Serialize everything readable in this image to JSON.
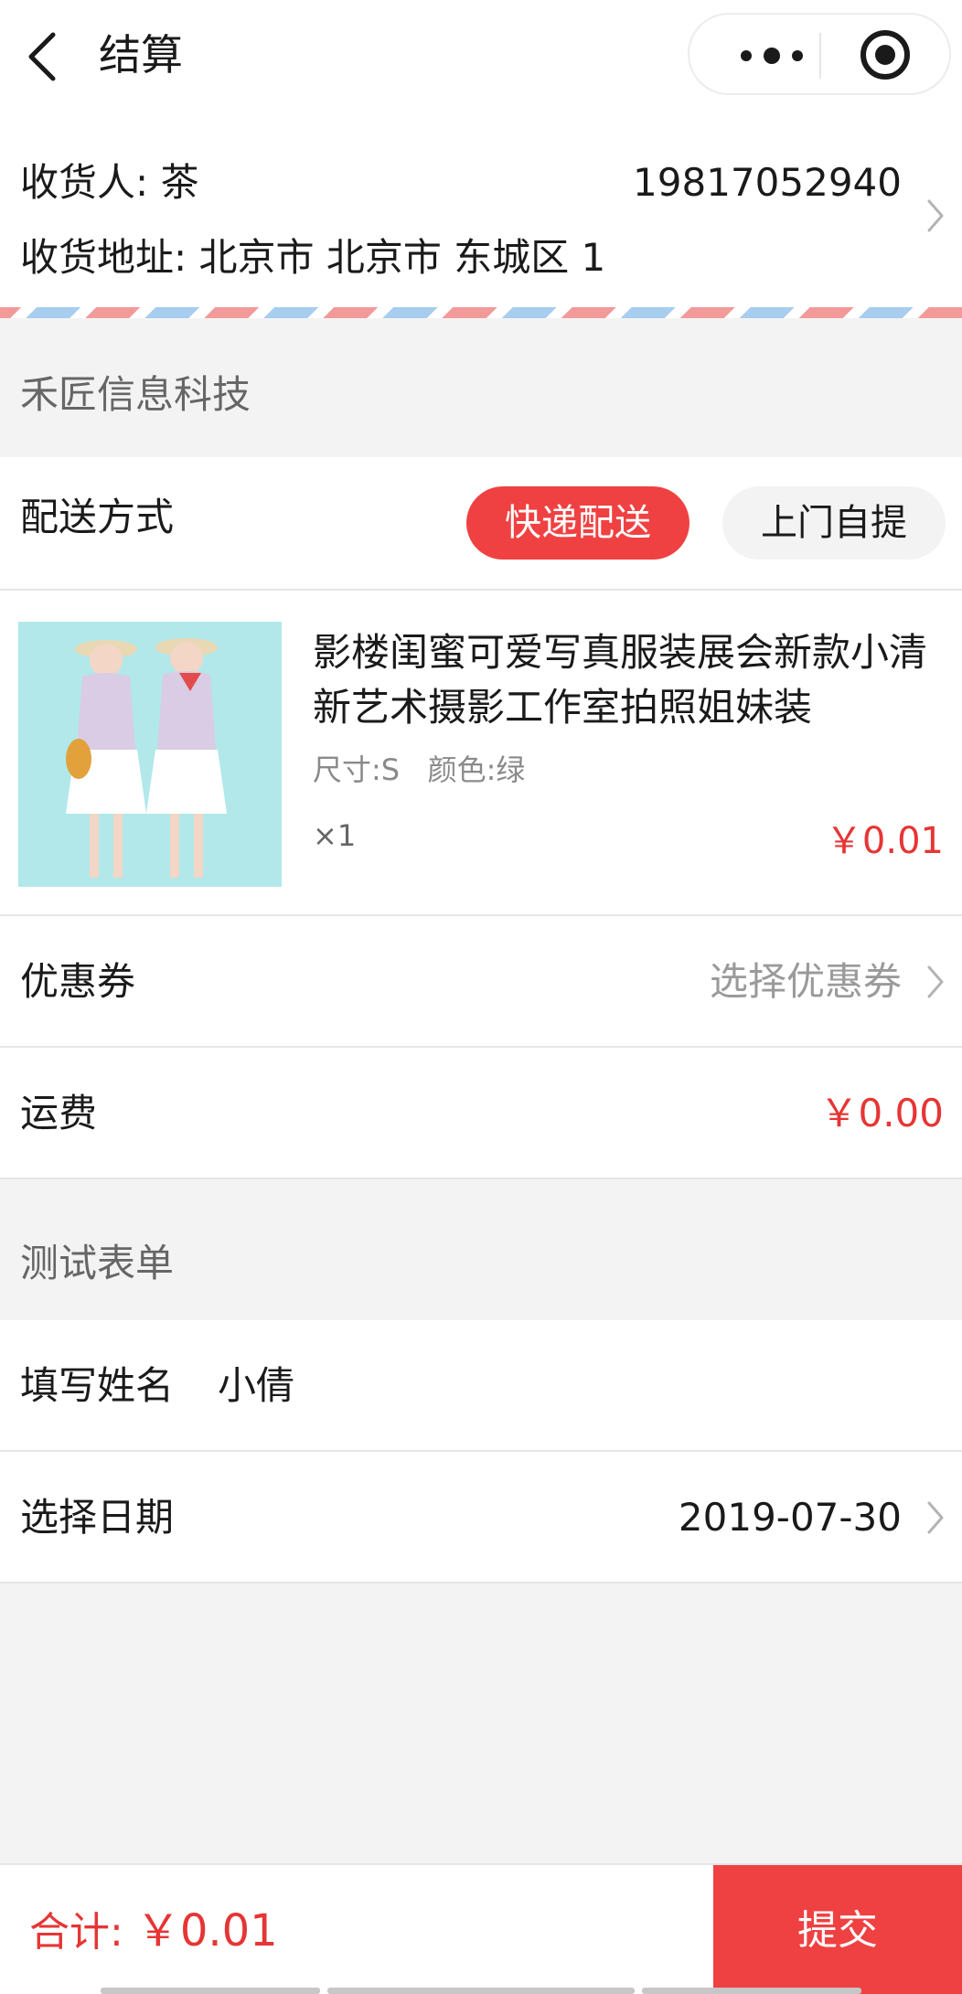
{
  "header": {
    "title": "结算"
  },
  "address": {
    "recipient": "收货人: 茶",
    "phone": "19817052940",
    "address": "收货地址: 北京市 北京市 东城区 1"
  },
  "shop": {
    "name": "禾匠信息科技"
  },
  "delivery": {
    "label": "配送方式",
    "options": [
      "快递配送",
      "上门自提"
    ],
    "selected": "快递配送"
  },
  "product": {
    "name": "影楼闺蜜可爱写真服装展会新款小清新艺术摄影工作室拍照姐妹装",
    "spec": "尺寸:S   颜色:绿",
    "quantity": "×1",
    "price": "￥0.01"
  },
  "coupon": {
    "label": "优惠券",
    "value": "选择优惠券"
  },
  "freight": {
    "label": "运费",
    "value": "￥0.00"
  },
  "form": {
    "title": "测试表单",
    "name_label": "填写姓名",
    "name_value": "小倩",
    "date_label": "选择日期",
    "date_value": "2019-07-30"
  },
  "footer": {
    "total_label": "合计:",
    "total_value": "￥0.01",
    "submit_label": "提交"
  },
  "colors": {
    "accent": "#f04142",
    "price": "#e63535",
    "background": "#f3f3f3"
  },
  "icons": [
    "back-arrow-icon",
    "more-dots-icon",
    "close-target-icon",
    "chevron-right-icon"
  ]
}
